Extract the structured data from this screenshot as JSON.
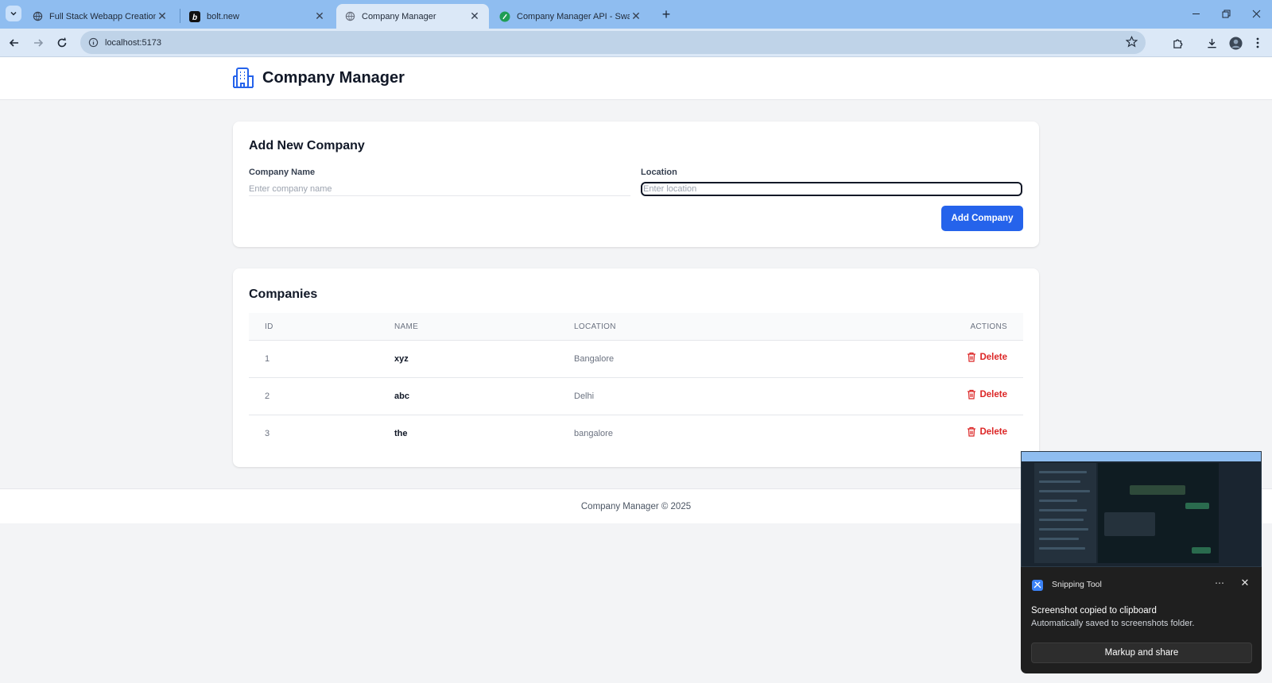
{
  "browser": {
    "tabs": [
      {
        "title": "Full Stack Webapp Creation",
        "icon": "globe-icon",
        "active": false
      },
      {
        "title": "bolt.new",
        "icon": "bolt-icon",
        "active": false
      },
      {
        "title": "Company Manager",
        "icon": "globe-icon",
        "active": true
      },
      {
        "title": "Company Manager API - Swagger UI",
        "icon": "swagger-icon",
        "active": false
      }
    ],
    "url": "localhost:5173",
    "tab_active_color": "#dbe8f7",
    "tabstrip_color": "#8fbdf0"
  },
  "app": {
    "title": "Company Manager",
    "brand_icon": "building-icon",
    "accent_color": "#2563eb",
    "danger_color": "#dc2626",
    "form": {
      "heading": "Add New Company",
      "name_label": "Company Name",
      "name_placeholder": "Enter company name",
      "name_value": "",
      "location_label": "Location",
      "location_placeholder": "Enter location",
      "location_value": "",
      "submit_label": "Add Company"
    },
    "list": {
      "heading": "Companies",
      "columns": [
        "ID",
        "NAME",
        "LOCATION",
        "ACTIONS"
      ],
      "rows": [
        {
          "id": "1",
          "name": "xyz",
          "location": "Bangalore",
          "action": "Delete"
        },
        {
          "id": "2",
          "name": "abc",
          "location": "Delhi",
          "action": "Delete"
        },
        {
          "id": "3",
          "name": "the",
          "location": "bangalore",
          "action": "Delete"
        }
      ]
    },
    "footer": "Company Manager © 2025"
  },
  "notification": {
    "app_name": "Snipping Tool",
    "title": "Screenshot copied to clipboard",
    "subtitle": "Automatically saved to screenshots folder.",
    "action_label": "Markup and share"
  }
}
